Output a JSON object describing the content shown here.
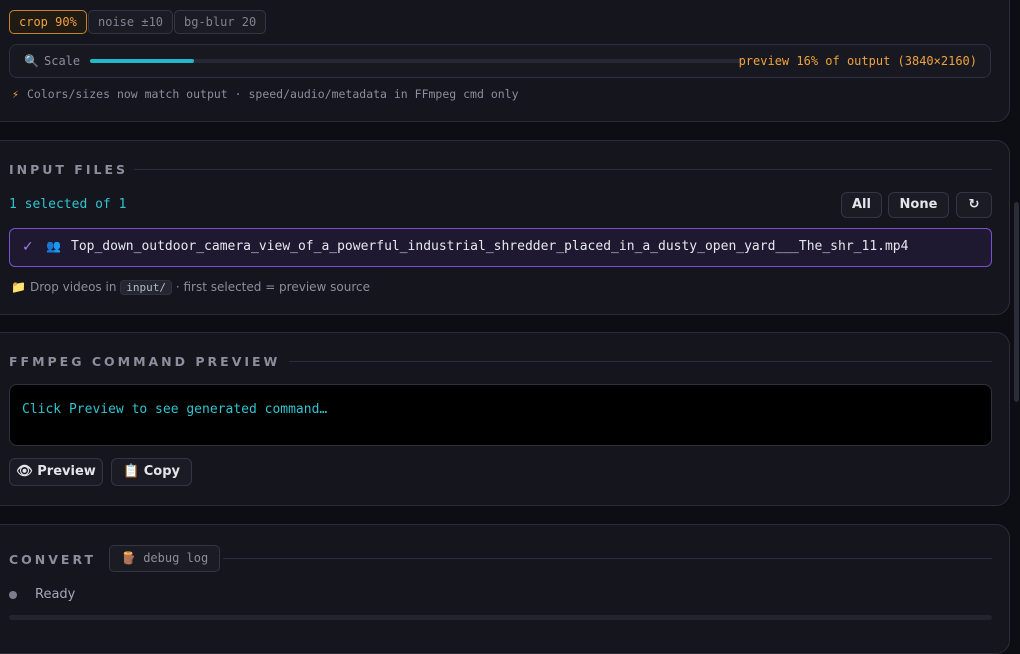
{
  "top_panel": {
    "chips": [
      {
        "label": "crop 90%",
        "active": true
      },
      {
        "label": "noise ±10",
        "active": false
      },
      {
        "label": "bg-blur 20",
        "active": false
      }
    ],
    "scale": {
      "icon": "search-icon",
      "label": "Scale",
      "fill_fraction": 0.16,
      "readout": "preview 16% of output (3840×2160)"
    },
    "note": {
      "icon": "lightning-icon",
      "text": "Colors/sizes now match output · speed/audio/metadata in FFmpeg cmd only"
    }
  },
  "input_files": {
    "title": "INPUT FILES",
    "selected_text": "1 selected of 1",
    "buttons": {
      "all": "All",
      "none": "None",
      "refresh": "↻"
    },
    "files": [
      {
        "check": "✓",
        "icon": "people-icon",
        "name": "Top_down_outdoor_camera_view_of_a_powerful_industrial_shredder_placed_in_a_dusty_open_yard___The_shr_11.mp4"
      }
    ],
    "hint": {
      "prefix": "Drop videos in",
      "path": "input/",
      "suffix": "· first selected = preview source"
    }
  },
  "ffmpeg_preview": {
    "title": "FFMPEG COMMAND PREVIEW",
    "placeholder": "Click Preview to see generated command…",
    "preview_button": "Preview",
    "copy_button": "Copy"
  },
  "convert": {
    "title": "CONVERT",
    "debug_label": "debug log",
    "status": "Ready",
    "progress_fraction": 0
  },
  "colors": {
    "accent_orange": "#f0a23c",
    "accent_cyan": "#2ec4d0",
    "accent_purple": "#7c4fd0",
    "background": "#0d0e14"
  }
}
